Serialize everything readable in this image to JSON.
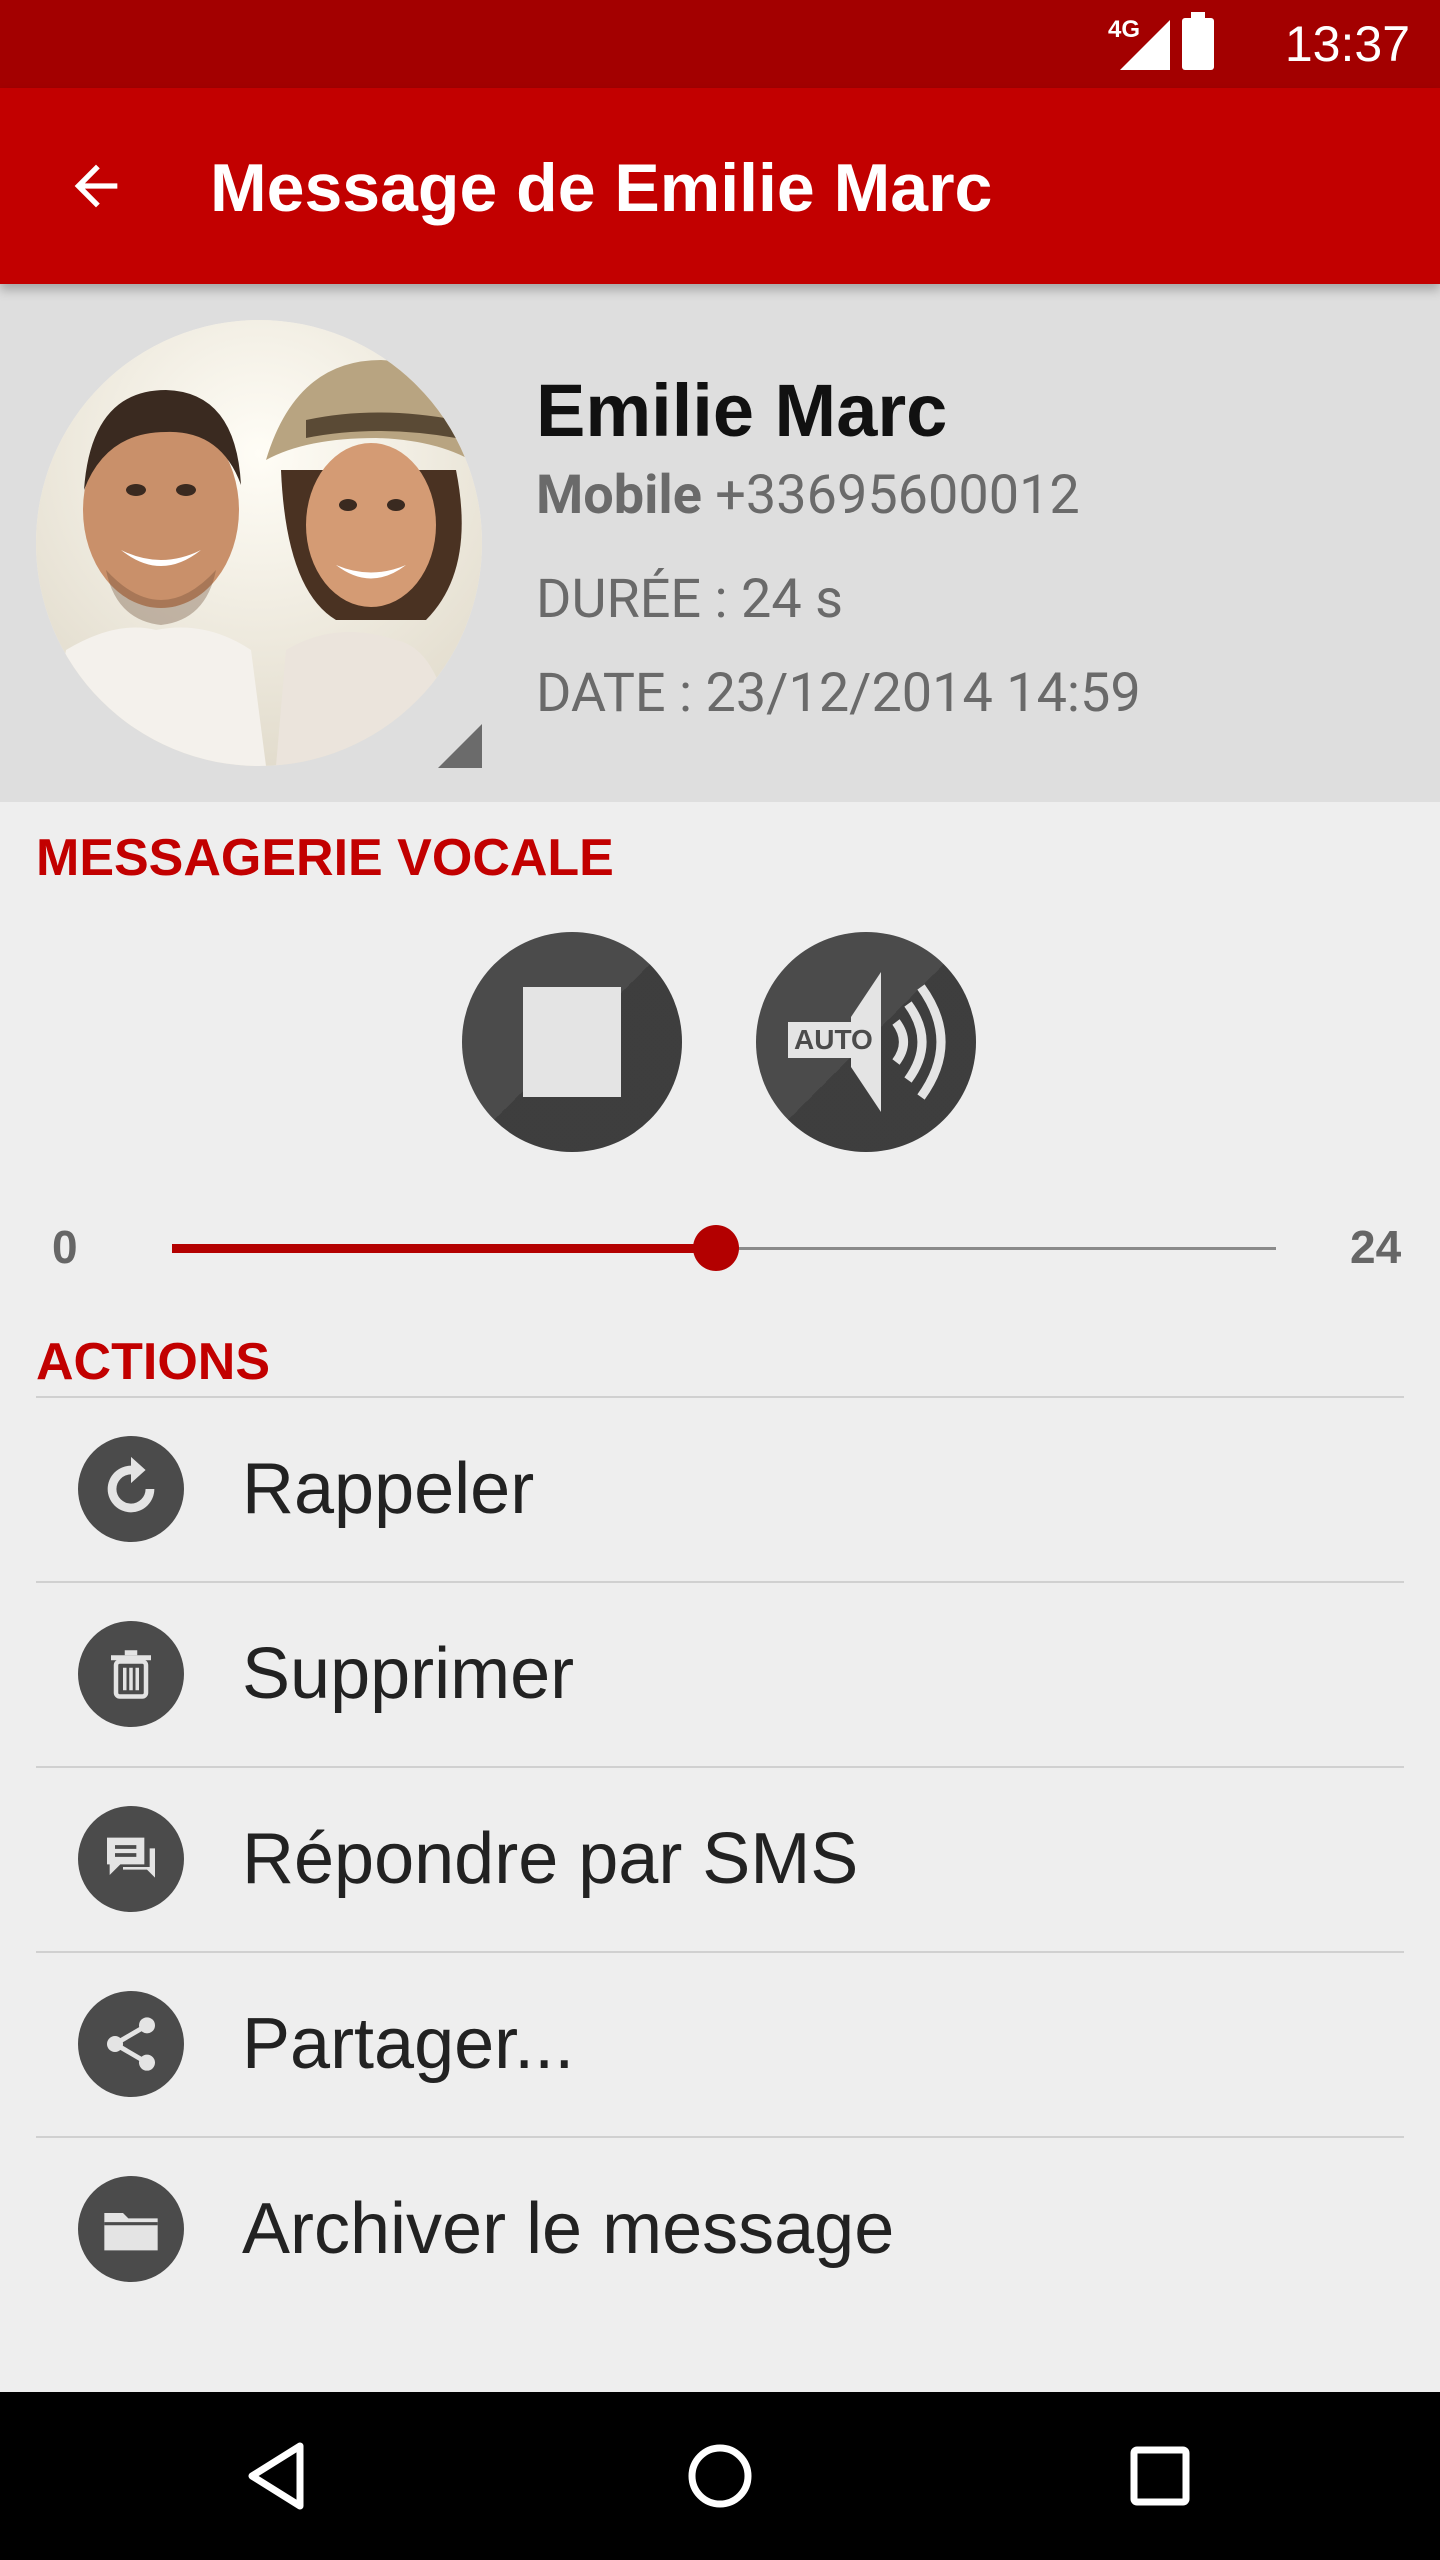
{
  "status_bar": {
    "network": "4G",
    "time": "13:37"
  },
  "app_bar": {
    "title": "Message de Emilie Marc"
  },
  "contact": {
    "name": "Emilie Marc",
    "phone_type": "Mobile",
    "phone_number": "+33695600012",
    "duration": "DURÉE : 24 s",
    "date": "DATE : 23/12/2014 14:59"
  },
  "voicemail": {
    "section_title": "MESSAGERIE VOCALE",
    "speaker_mode": "AUTO",
    "seek_min": "0",
    "seek_max": "24",
    "progress_fraction": 0.493
  },
  "actions": {
    "section_title": "ACTIONS",
    "items": [
      {
        "label": "Rappeler",
        "icon": "callback-icon"
      },
      {
        "label": "Supprimer",
        "icon": "trash-icon"
      },
      {
        "label": "Répondre par SMS",
        "icon": "sms-icon"
      },
      {
        "label": "Partager...",
        "icon": "share-icon"
      },
      {
        "label": "Archiver le message",
        "icon": "folder-icon"
      }
    ]
  },
  "colors": {
    "status_bar": "#a30000",
    "app_bar": "#c20000",
    "accent": "#b30000",
    "icon_bg": "#4b4b4b"
  }
}
